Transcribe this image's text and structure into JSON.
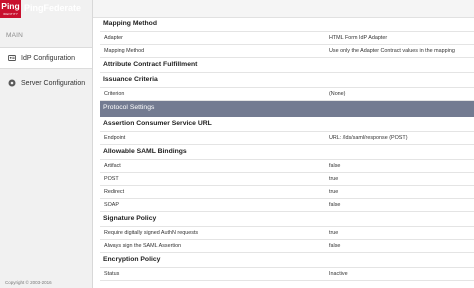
{
  "brand": {
    "logo_text": "Ping",
    "logo_subtext": "IDENTITY",
    "product_name": "PingFederate"
  },
  "sidebar": {
    "section_label": "MAIN",
    "items": [
      {
        "label": "IdP Configuration",
        "icon": "id-card-icon",
        "active": true
      },
      {
        "label": "Server Configuration",
        "icon": "server-icon",
        "active": false
      }
    ],
    "copyright": "Copyright © 2003-2016"
  },
  "rows": [
    {
      "kind": "header",
      "title": "Mapping Method"
    },
    {
      "kind": "value",
      "key": "Adapter",
      "value": "HTML Form IdP Adapter"
    },
    {
      "kind": "value",
      "key": "Mapping Method",
      "value": "Use only the Adapter Contract values in the mapping"
    },
    {
      "kind": "header",
      "title": "Attribute Contract Fulfillment"
    },
    {
      "kind": "header",
      "title": "Issuance Criteria"
    },
    {
      "kind": "value",
      "key": "Criterion",
      "value": "(None)"
    },
    {
      "kind": "band",
      "title": "Protocol Settings"
    },
    {
      "kind": "header",
      "title": "Assertion Consumer Service URL"
    },
    {
      "kind": "value",
      "key": "Endpoint",
      "value": "URL: /lds/saml/response (POST)"
    },
    {
      "kind": "header",
      "title": "Allowable SAML Bindings"
    },
    {
      "kind": "value",
      "key": "Artifact",
      "value": "false"
    },
    {
      "kind": "value",
      "key": "POST",
      "value": "true"
    },
    {
      "kind": "value",
      "key": "Redirect",
      "value": "true"
    },
    {
      "kind": "value",
      "key": "SOAP",
      "value": "false"
    },
    {
      "kind": "header",
      "title": "Signature Policy"
    },
    {
      "kind": "value",
      "key": "Require digitally signed AuthN requests",
      "value": "true"
    },
    {
      "kind": "value",
      "key": "Always sign the SAML Assertion",
      "value": "false"
    },
    {
      "kind": "header",
      "title": "Encryption Policy"
    },
    {
      "kind": "value",
      "key": "Status",
      "value": "Inactive"
    }
  ],
  "colors": {
    "brand_red": "#c8102e",
    "topbar_dark": "#2e3238",
    "section_band": "#737b91"
  }
}
